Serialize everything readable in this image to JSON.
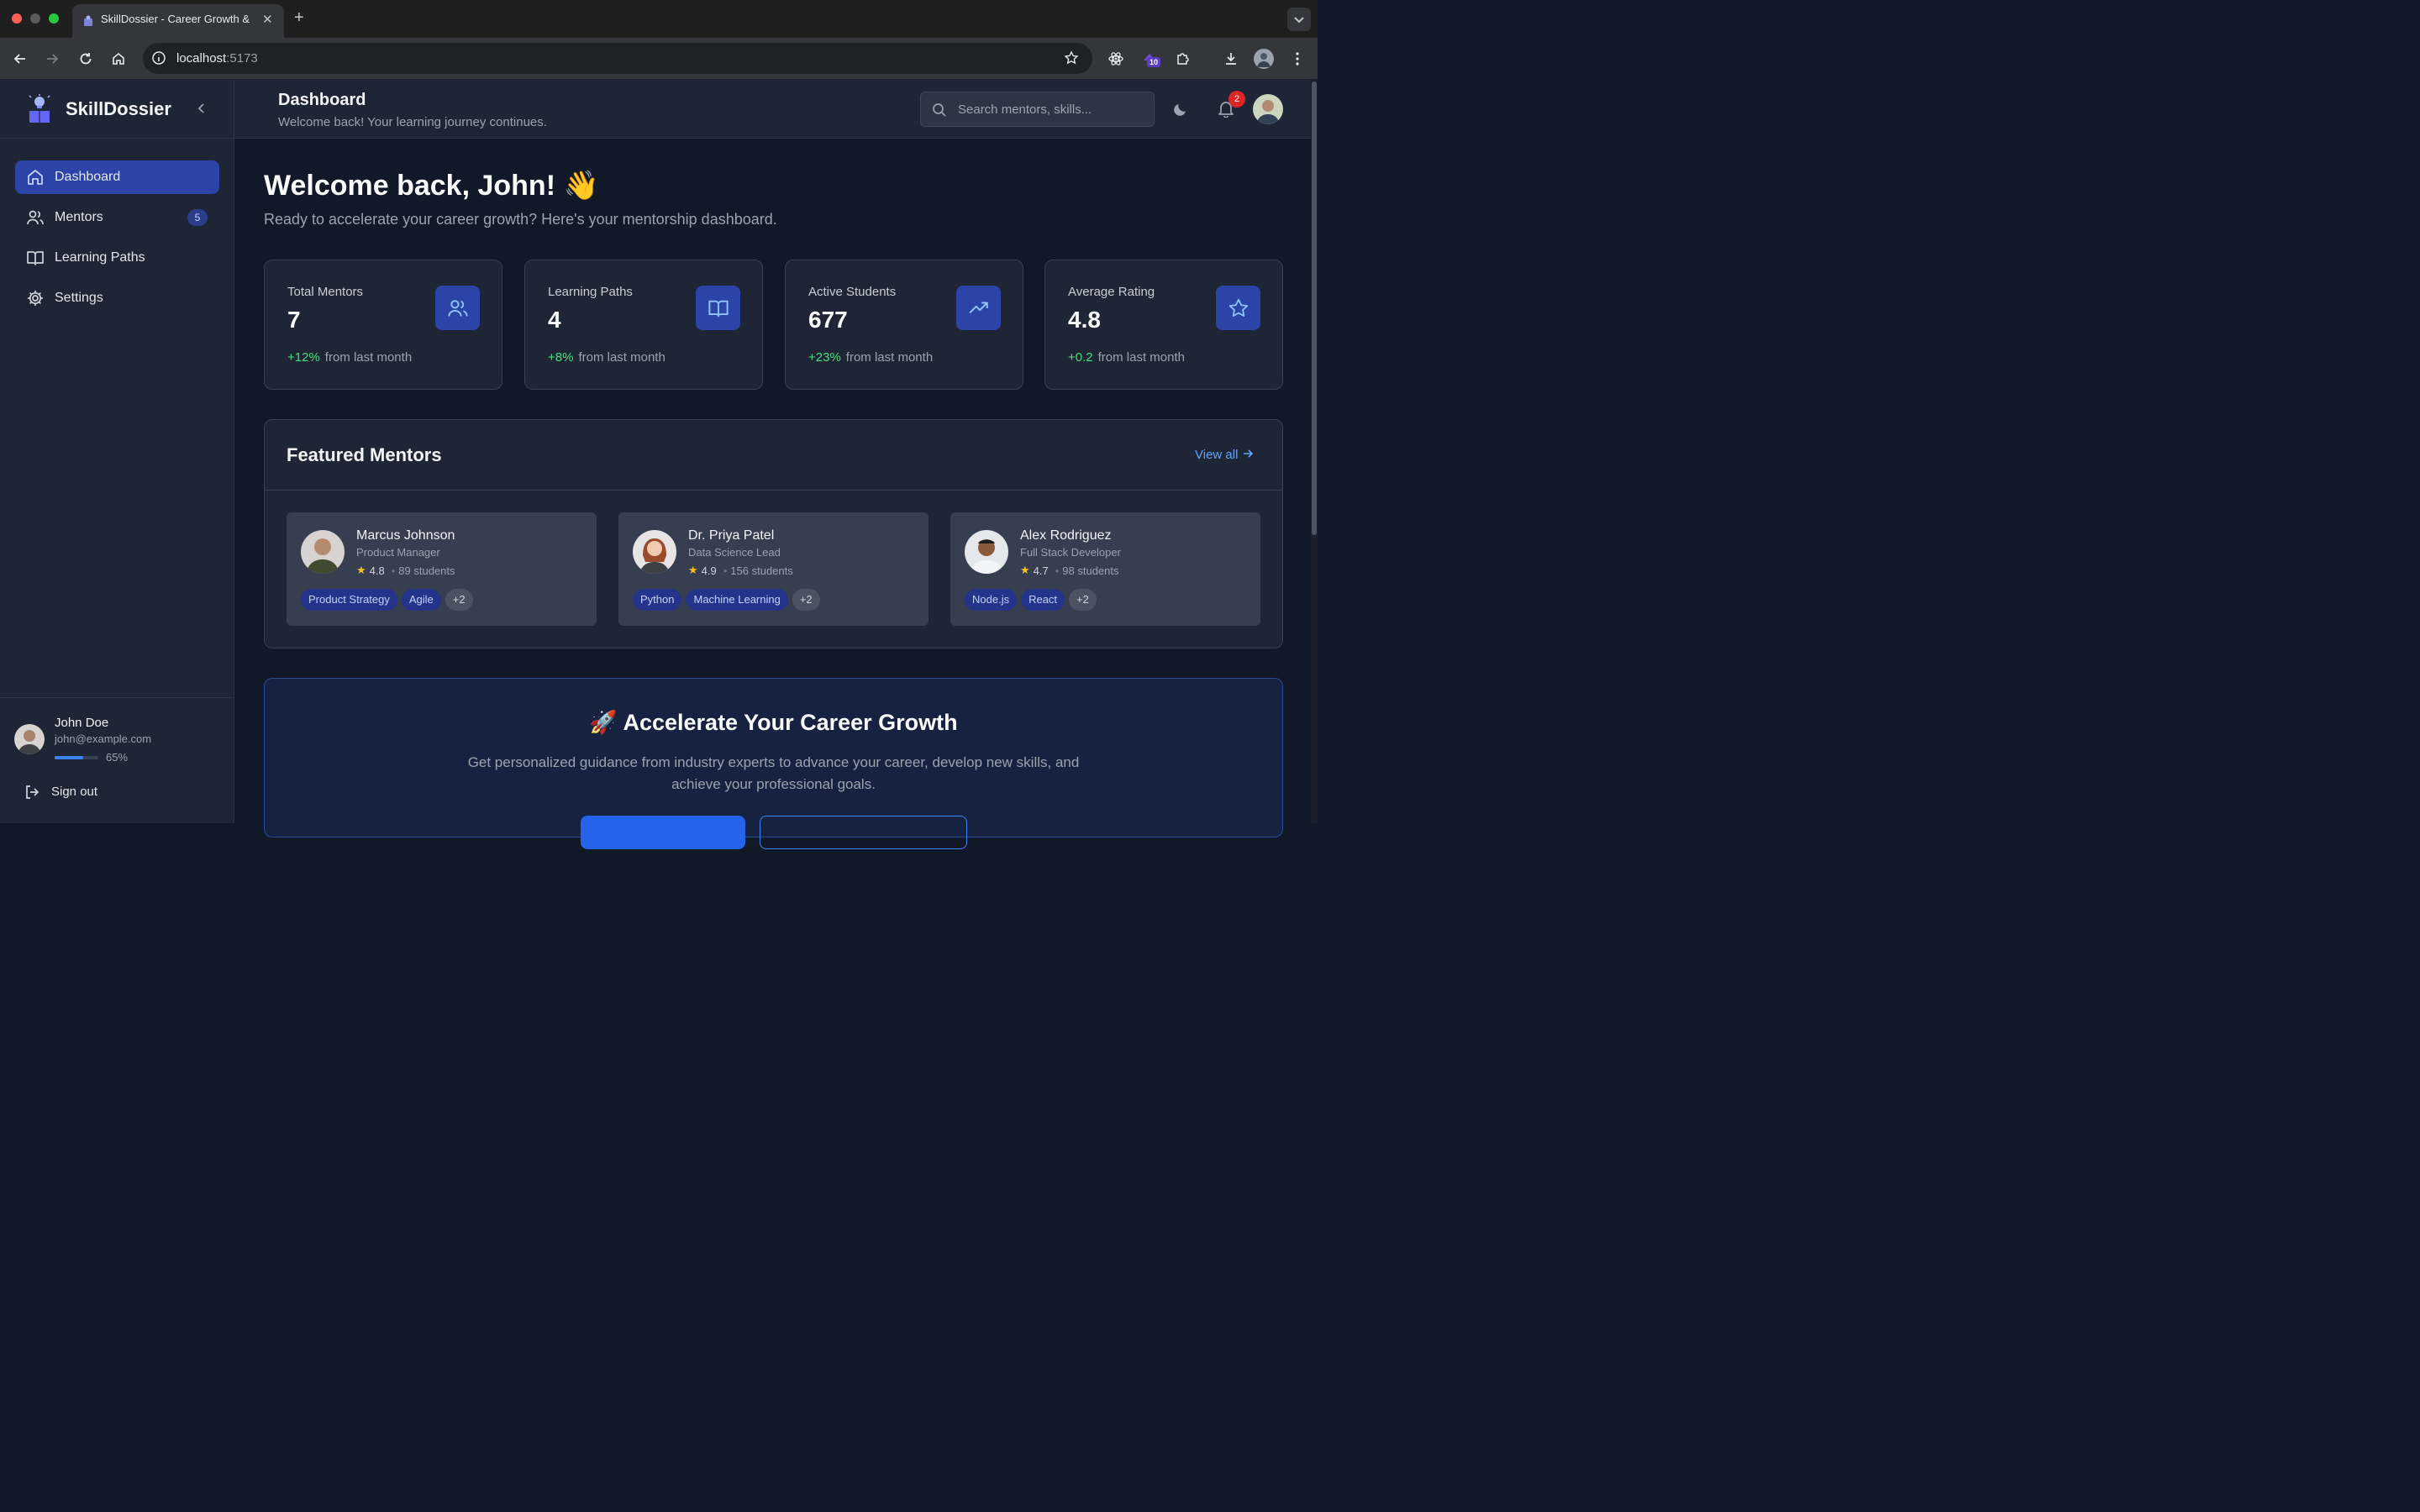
{
  "browser": {
    "tab_title": "SkillDossier - Career Growth & Mentorship",
    "url_host": "localhost",
    "url_port": ":5173",
    "extension_badge": "10"
  },
  "brand": {
    "name": "SkillDossier"
  },
  "sidebar": {
    "items": [
      {
        "label": "Dashboard",
        "icon": "home-icon",
        "active": true
      },
      {
        "label": "Mentors",
        "icon": "users-icon",
        "badge": "5"
      },
      {
        "label": "Learning Paths",
        "icon": "book-icon"
      },
      {
        "label": "Settings",
        "icon": "gear-icon"
      }
    ],
    "user": {
      "name": "John Doe",
      "email": "john@example.com",
      "progress": 65,
      "progress_label": "65%"
    },
    "signout_label": "Sign out"
  },
  "header": {
    "title": "Dashboard",
    "subtitle": "Welcome back! Your learning journey continues.",
    "search_placeholder": "Search mentors, skills...",
    "notification_count": "2"
  },
  "main": {
    "welcome": "Welcome back, John! 👋",
    "welcome_sub": "Ready to accelerate your career growth? Here's your mentorship dashboard.",
    "stats": [
      {
        "label": "Total Mentors",
        "value": "7",
        "delta": "+12%",
        "note": "from last month",
        "icon": "users-icon"
      },
      {
        "label": "Learning Paths",
        "value": "4",
        "delta": "+8%",
        "note": "from last month",
        "icon": "book-icon"
      },
      {
        "label": "Active Students",
        "value": "677",
        "delta": "+23%",
        "note": "from last month",
        "icon": "trending-up-icon"
      },
      {
        "label": "Average Rating",
        "value": "4.8",
        "delta": "+0.2",
        "note": "from last month",
        "icon": "star-icon"
      }
    ],
    "featured": {
      "title": "Featured Mentors",
      "view_all": "View all",
      "mentors": [
        {
          "name": "Marcus Johnson",
          "role": "Product Manager",
          "rating": "4.8",
          "students": "89 students",
          "tags": [
            "Product Strategy",
            "Agile"
          ],
          "more": "+2"
        },
        {
          "name": "Dr. Priya Patel",
          "role": "Data Science Lead",
          "rating": "4.9",
          "students": "156 students",
          "tags": [
            "Python",
            "Machine Learning"
          ],
          "more": "+2"
        },
        {
          "name": "Alex Rodriguez",
          "role": "Full Stack Developer",
          "rating": "4.7",
          "students": "98 students",
          "tags": [
            "Node.js",
            "React"
          ],
          "more": "+2"
        }
      ]
    },
    "cta": {
      "title": "🚀 Accelerate Your Career Growth",
      "text": "Get personalized guidance from industry experts to advance your career, develop new skills, and achieve your professional goals."
    }
  },
  "colors": {
    "accent": "#2c43a8",
    "positive": "#4ade80",
    "link": "#60a5fa",
    "background": "#111827",
    "panel": "#1e2534"
  }
}
